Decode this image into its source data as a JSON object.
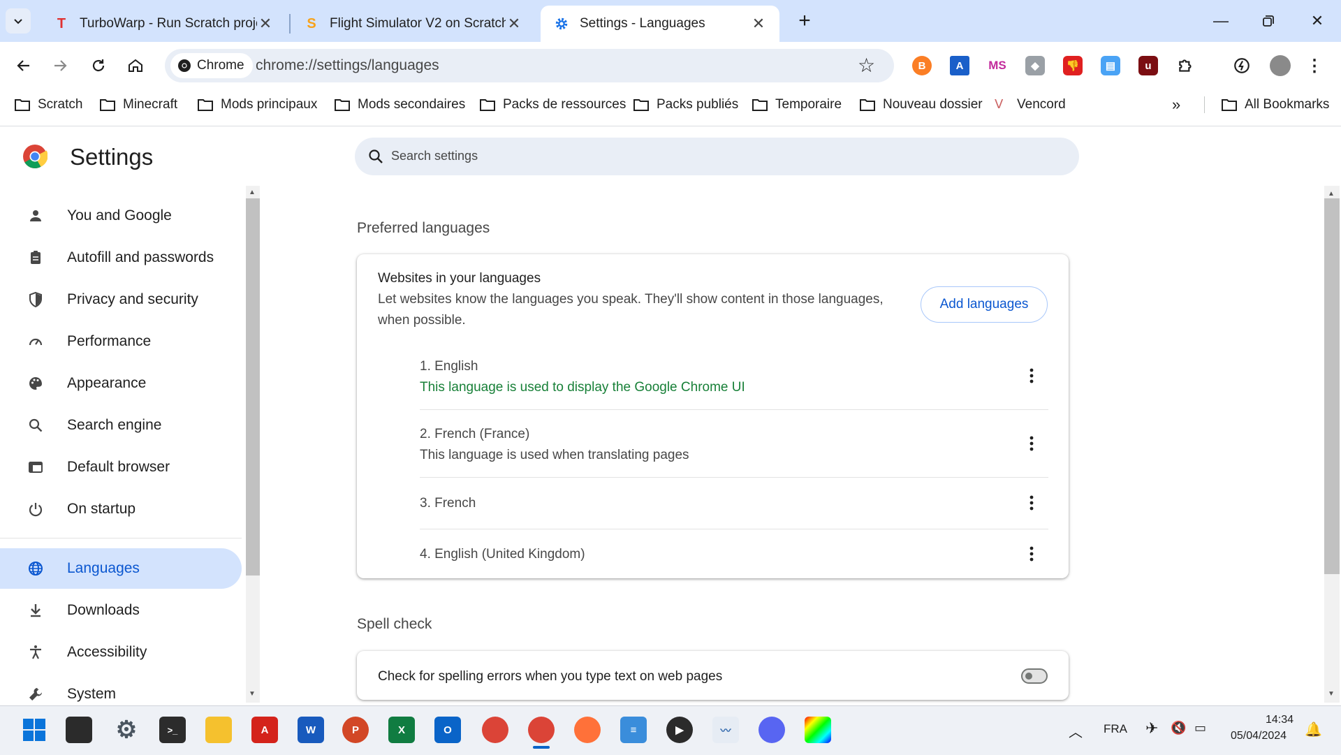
{
  "tabs": [
    {
      "title": "TurboWarp - Run Scratch projects faster",
      "active": false
    },
    {
      "title": "Flight Simulator V2 on Scratch",
      "active": false
    },
    {
      "title": "Settings - Languages",
      "active": true
    }
  ],
  "omnibox": {
    "chip": "Chrome",
    "url": "chrome://settings/languages"
  },
  "extensions": [
    "brave-icon",
    "translate-icon",
    "ms-icon",
    "gamepad-icon",
    "dislike-icon",
    "clipboard-icon",
    "ublock-icon",
    "puzzle-icon",
    "performance-icon"
  ],
  "bookmarks": [
    "Scratch",
    "Minecraft",
    "Mods principaux",
    "Mods secondaires",
    "Packs de ressources",
    "Packs publiés",
    "Temporaire",
    "Nouveau dossier",
    "Vencord"
  ],
  "all_bookmarks": "All Bookmarks",
  "settings": {
    "title": "Settings",
    "search_placeholder": "Search settings",
    "nav": [
      "You and Google",
      "Autofill and passwords",
      "Privacy and security",
      "Performance",
      "Appearance",
      "Search engine",
      "Default browser",
      "On startup",
      "Languages",
      "Downloads",
      "Accessibility",
      "System"
    ],
    "selected": "Languages"
  },
  "preferred": {
    "heading": "Preferred languages",
    "card_title": "Websites in your languages",
    "card_desc_1": "Let websites know the languages you speak. They'll show content in those languages,",
    "card_desc_2": "when possible.",
    "add_button": "Add languages",
    "languages": [
      {
        "name": "1. English",
        "note": "This language is used to display the Google Chrome UI"
      },
      {
        "name": "2. French (France)",
        "note": "This language is used when translating pages"
      },
      {
        "name": "3. French",
        "note": ""
      },
      {
        "name": "4. English (United Kingdom)",
        "note": ""
      }
    ]
  },
  "spell": {
    "heading": "Spell check",
    "row": "Check for spelling errors when you type text on web pages",
    "enabled": false
  },
  "taskbar": {
    "lang": "FRA",
    "time": "14:34",
    "date": "05/04/2024"
  },
  "colors": {
    "accent": "#0b57d0",
    "ui_note": "#188038",
    "tabstrip": "#d3e3fd"
  }
}
